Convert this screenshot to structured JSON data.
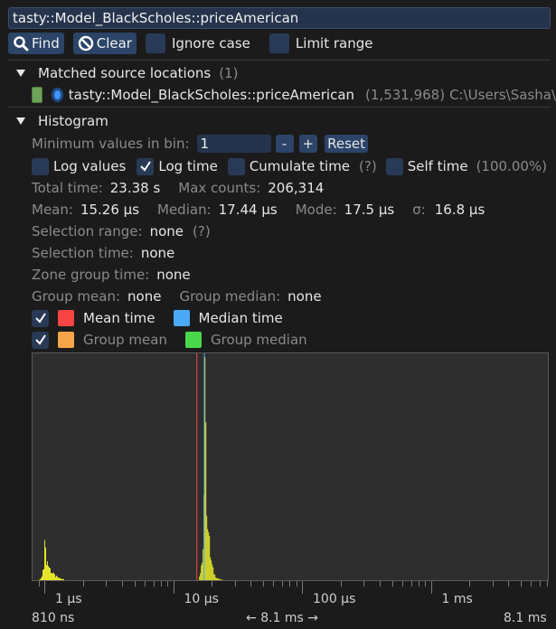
{
  "search": {
    "value": "tasty::Model_BlackScholes::priceAmerican"
  },
  "toolbar": {
    "find_label": "Find",
    "clear_label": "Clear",
    "ignore_case_label": "Ignore case",
    "limit_range_label": "Limit range"
  },
  "matched": {
    "header": "Matched source locations",
    "count": "(1)",
    "item_name": "tasty::Model_BlackScholes::priceAmerican",
    "item_count": "(1,531,968)",
    "item_path": "C:\\Users\\Sasha\\",
    "swatch_color": "#6fa25a"
  },
  "histogram": {
    "header": "Histogram",
    "min_values_label": "Minimum values in bin:",
    "min_values_value": "1",
    "minus_label": "-",
    "plus_label": "+",
    "reset_label": "Reset",
    "log_values_label": "Log values",
    "log_values_checked": false,
    "log_time_label": "Log time",
    "log_time_checked": true,
    "cumulate_label": "Cumulate time",
    "cumulate_hint": "(?)",
    "self_time_label": "Self time",
    "self_time_pct": "(100.00%)",
    "total_time_label": "Total time:",
    "total_time_value": "23.38 s",
    "max_counts_label": "Max counts:",
    "max_counts_value": "206,314",
    "mean_label": "Mean:",
    "mean_value": "15.26 μs",
    "median_label": "Median:",
    "median_value": "17.44 μs",
    "mode_label": "Mode:",
    "mode_value": "17.5 μs",
    "sigma_label": "σ:",
    "sigma_value": "16.8 μs",
    "sel_range_label": "Selection range:",
    "sel_range_value": "none",
    "sel_range_hint": "(?)",
    "sel_time_label": "Selection time:",
    "sel_time_value": "none",
    "zone_group_label": "Zone group time:",
    "zone_group_value": "none",
    "group_mean_label": "Group mean:",
    "group_mean_value": "none",
    "group_median_label": "Group median:",
    "group_median_value": "none",
    "mean_time_label": "Mean time",
    "median_time_label": "Median time",
    "group_mean_legend": "Group mean",
    "group_median_legend": "Group median",
    "colors": {
      "mean": "#f94444",
      "median": "#4aa8f5",
      "group_mean": "#f5a44a",
      "group_median": "#4ad64a",
      "bars": "#e4e42a"
    }
  },
  "axis": {
    "ticks": [
      "1 μs",
      "10 μs",
      "100 μs",
      "1 ms"
    ],
    "min_label": "810 ns",
    "max_label": "8.1 ms",
    "range_label": "8.1 ms"
  },
  "chart_data": {
    "type": "bar",
    "xscale": "log",
    "xlim_ns": [
      810,
      8100000
    ],
    "mean_us": 15.26,
    "median_us": 17.44,
    "clusters": [
      {
        "center_us": 1.0,
        "relative_height": 0.18
      },
      {
        "center_us": 17.5,
        "relative_height": 1.0
      }
    ]
  }
}
